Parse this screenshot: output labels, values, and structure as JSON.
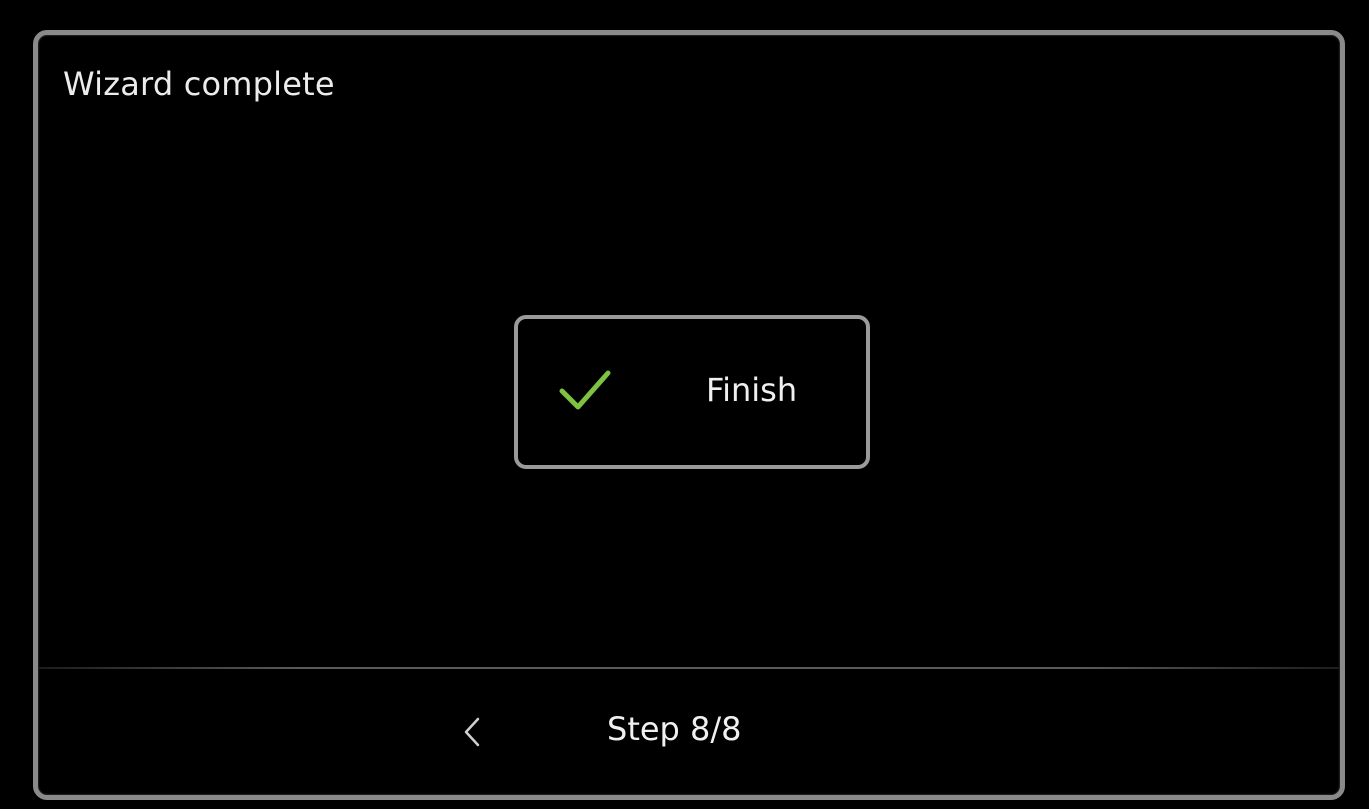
{
  "wizard": {
    "title": "Wizard complete",
    "finish_label": "Finish",
    "step_text": "Step 8/8",
    "check_color": "#7dc243"
  },
  "icons": {
    "finish": "check-icon",
    "back": "chevron-left-icon"
  }
}
